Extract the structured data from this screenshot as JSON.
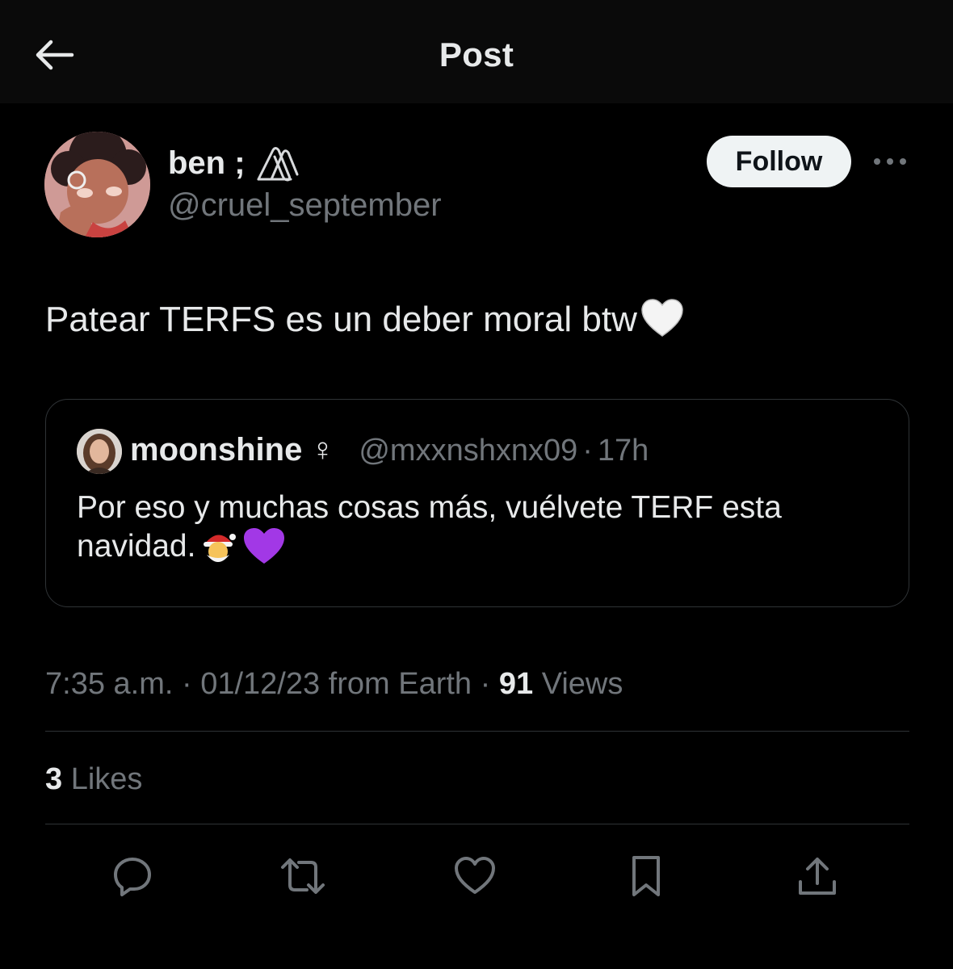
{
  "header": {
    "back_icon": "arrow-left-icon",
    "title": "Post"
  },
  "author": {
    "display_name": "ben ;",
    "name_icon": "paperclip-icon",
    "handle": "@cruel_september",
    "follow_label": "Follow",
    "more_icon": "more-horizontal-icon"
  },
  "post": {
    "text": "Patear TERFS es un deber moral btw",
    "emoji": "white-heart-icon"
  },
  "quote": {
    "name": "moonshine",
    "name_symbol": "♀",
    "handle": "@mxxnshxnx09",
    "separator": "·",
    "time": "17h",
    "text": "Por eso y muchas cosas más, vuélvete TERF esta navidad.",
    "emojis": [
      "santa-icon",
      "purple-heart-icon"
    ]
  },
  "meta": {
    "time": "7:35 a.m.",
    "sep1": "·",
    "date": "01/12/23 from Earth",
    "sep2": "·",
    "views_count": "91",
    "views_label": "Views"
  },
  "engagement": {
    "likes_count": "3",
    "likes_label": "Likes"
  },
  "actions": [
    {
      "icon": "reply-icon"
    },
    {
      "icon": "repost-icon"
    },
    {
      "icon": "like-icon"
    },
    {
      "icon": "bookmark-icon"
    },
    {
      "icon": "share-icon"
    }
  ],
  "colors": {
    "background": "#000000",
    "header_bg": "#0a0a0a",
    "text_primary": "#e7e9ea",
    "text_secondary": "#71767b",
    "border": "#2f3336",
    "follow_bg": "#eff3f4"
  }
}
